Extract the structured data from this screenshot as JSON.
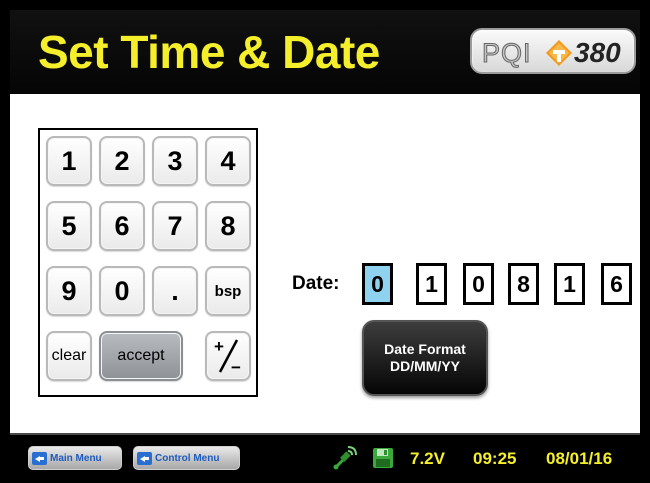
{
  "header": {
    "title": "Set Time & Date",
    "logo": {
      "left_text": "PQI",
      "number_text": "380"
    }
  },
  "keypad": {
    "keys": [
      "1",
      "2",
      "3",
      "4",
      "5",
      "6",
      "7",
      "8",
      "9",
      "0",
      ".",
      "bsp"
    ],
    "clear_label": "clear",
    "accept_label": "accept",
    "plusminus_top": "+",
    "plusminus_bottom": "−"
  },
  "date": {
    "label": "Date:",
    "digits": [
      "0",
      "1",
      "0",
      "8",
      "1",
      "6"
    ],
    "active_index": 0
  },
  "format_button": {
    "line1": "Date Format",
    "line2": "DD/MM/YY"
  },
  "footer": {
    "main_menu_label": "Main Menu",
    "control_menu_label": "Control Menu",
    "voltage": "7.2V",
    "time": "09:25",
    "date": "08/01/16"
  },
  "colors": {
    "title_yellow": "#f4ee2b",
    "active_digit_blue": "#8fd2f0",
    "accept_gray": "#9ea2a6",
    "gps_green": "#3aa83a"
  },
  "icons": {
    "gps": "satellite-signal-icon",
    "save": "floppy-disk-icon",
    "nav": "back-arrow-icon",
    "logo_mark": "orange-arrow-t-icon"
  }
}
